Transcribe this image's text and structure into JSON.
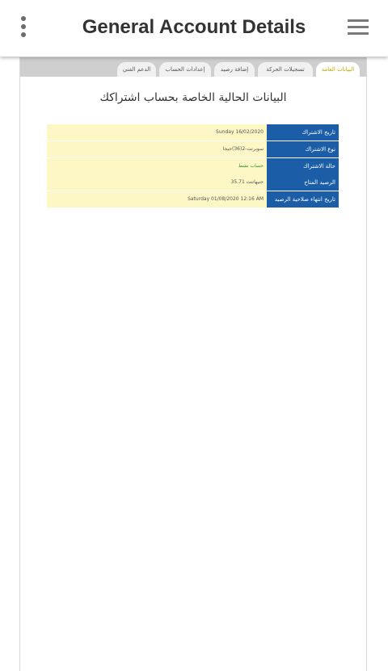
{
  "appbar": {
    "title": "General Account Details"
  },
  "tabs": [
    {
      "label": "البيانات العامة",
      "active": true
    },
    {
      "label": "تسجيلات الحركة",
      "active": false
    },
    {
      "label": "إضافة رصيد",
      "active": false
    },
    {
      "label": "إعدادات الحساب",
      "active": false
    },
    {
      "label": "الدعم الفني",
      "active": false
    }
  ],
  "content": {
    "heading": "البيانات الحالية الخاصة بحساب اشتراكك",
    "rows": [
      {
        "label": "تاريخ الاشتراك",
        "value": "Sunday 16/02/2020"
      },
      {
        "label": "نوع الاشتراك",
        "value": "سوبرنت-2(36)جيجا"
      },
      {
        "label": "حالة الاشتراك",
        "value": "حساب نشط",
        "value_color": "#2e9a2e"
      },
      {
        "label": "الرصيد المتاح",
        "value": "جنيهاتنت 35.71"
      },
      {
        "label": "تاريخ انتهاء صلاحية الرصيد",
        "value": "Saturday 01/08/2020 12:16 AM"
      }
    ]
  },
  "colors": {
    "label_bg": "#1b5da6",
    "value_bg": "#fdf7c6",
    "active_tab_text": "#c8a000"
  }
}
